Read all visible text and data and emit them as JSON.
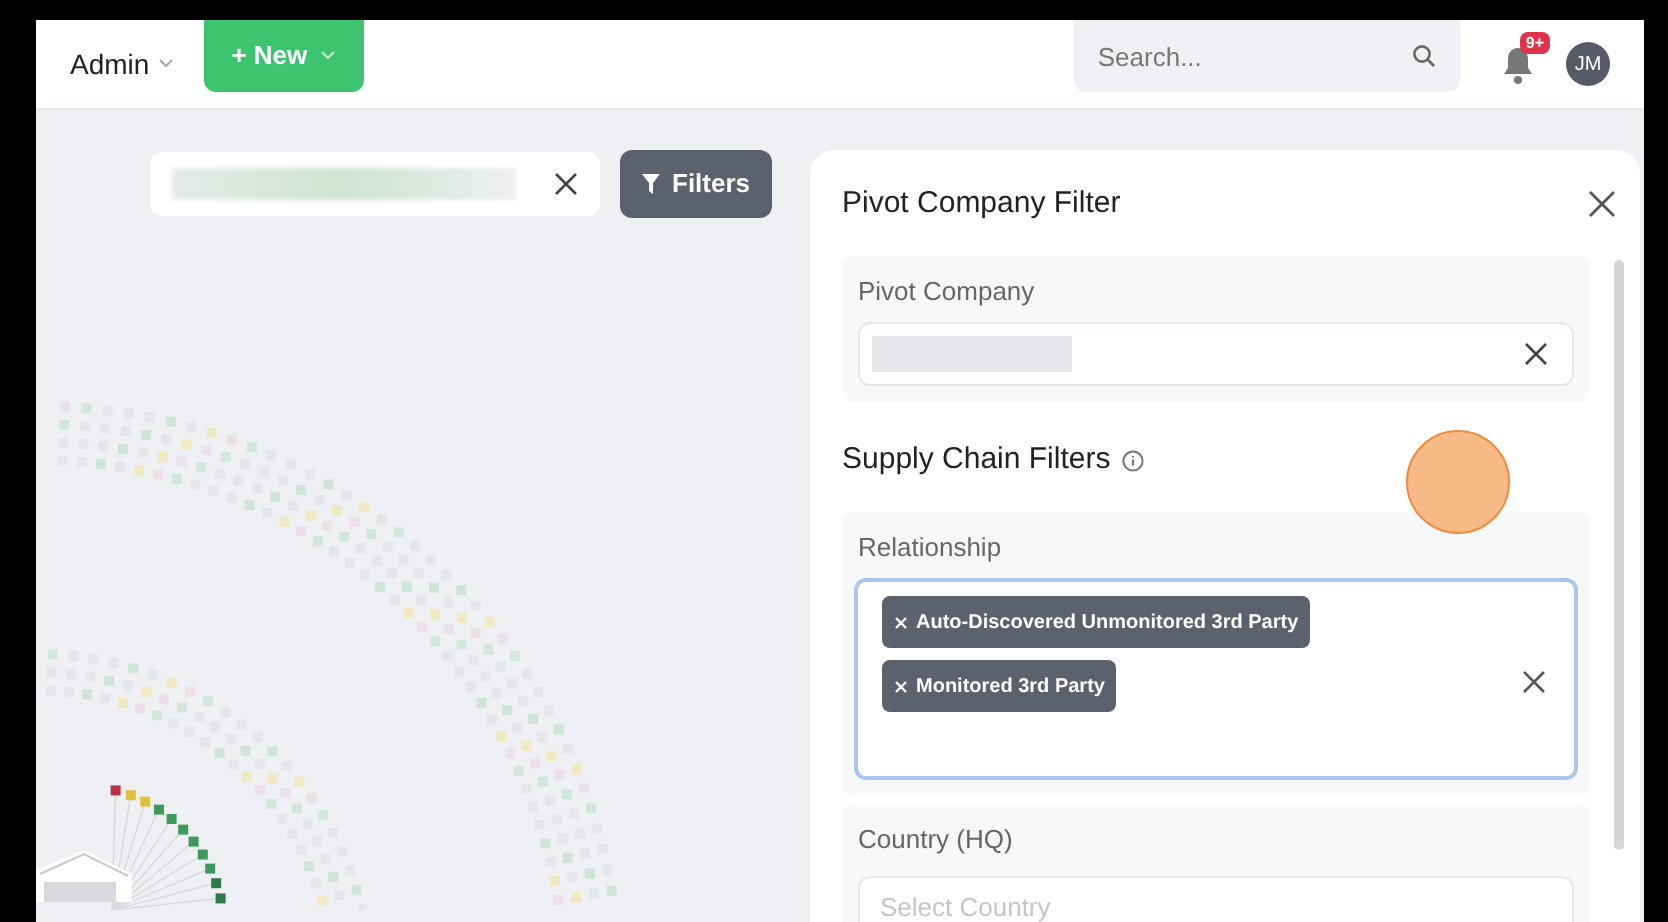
{
  "header": {
    "workspace": "Admin",
    "new_button": "+ New",
    "search": {
      "placeholder": "Search..."
    },
    "notifications": {
      "badge": "9+"
    },
    "avatar": {
      "initials": "JM"
    }
  },
  "graph_toolbar": {
    "filters_button": "Filters"
  },
  "panel": {
    "title": "Pivot Company Filter",
    "pivot_company": {
      "label": "Pivot Company"
    },
    "section_title": "Supply Chain Filters",
    "relationship": {
      "label": "Relationship",
      "focused": true,
      "tags": [
        "Auto-Discovered Unmonitored 3rd Party",
        "Monitored 3rd Party"
      ]
    },
    "country": {
      "label": "Country (HQ)",
      "placeholder": "Select Country"
    }
  }
}
